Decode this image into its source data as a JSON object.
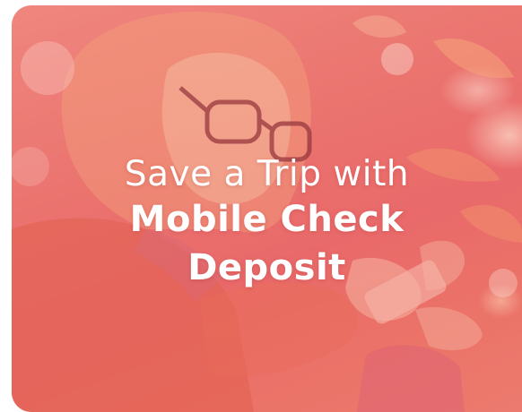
{
  "promo": {
    "headline_line1": "Save a Trip with",
    "headline_line2": "Mobile Check",
    "headline_line3": "Deposit"
  },
  "colors": {
    "overlay": "#ea7670",
    "text": "#ffffff"
  }
}
